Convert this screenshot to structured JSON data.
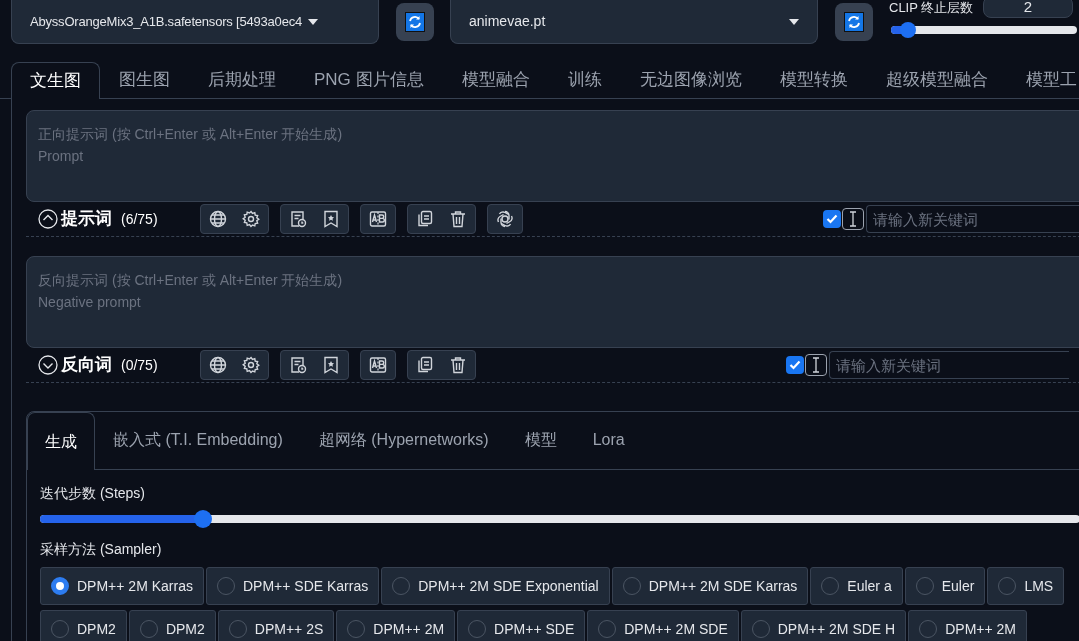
{
  "checkpoint": {
    "value": "AbyssOrangeMix3_A1B.safetensors [5493a0ec4"
  },
  "vae": {
    "value": "animevae.pt"
  },
  "clip_skip": {
    "label": "CLIP 终止层数",
    "value": "2",
    "level": 0.09
  },
  "tabs": [
    {
      "label": "文生图",
      "selected": true
    },
    {
      "label": "图生图",
      "selected": false
    },
    {
      "label": "后期处理",
      "selected": false
    },
    {
      "label": "PNG 图片信息",
      "selected": false
    },
    {
      "label": "模型融合",
      "selected": false
    },
    {
      "label": "训练",
      "selected": false
    },
    {
      "label": "无边图像浏览",
      "selected": false
    },
    {
      "label": "模型转换",
      "selected": false
    },
    {
      "label": "超级模型融合",
      "selected": false
    },
    {
      "label": "模型工",
      "selected": false
    }
  ],
  "prompts": [
    {
      "placeholder": "正向提示词 (按 Ctrl+Enter 或 Alt+Enter 开始生成)\nPrompt",
      "title": "提示词",
      "count": "(6/75)",
      "expanded": true,
      "tool_groups": [
        {
          "tools": [
            {
              "kind": "globe"
            },
            {
              "kind": "gear"
            }
          ]
        },
        {
          "tools": [
            {
              "kind": "history"
            },
            {
              "kind": "bookmark"
            }
          ]
        },
        {
          "tools": [
            {
              "kind": "ab"
            }
          ]
        },
        {
          "tools": [
            {
              "kind": "copy"
            },
            {
              "kind": "trash"
            }
          ]
        },
        {
          "tools": [
            {
              "kind": "ai"
            }
          ]
        }
      ],
      "keyword_toggle": {
        "checked": true
      },
      "keyword_field": {
        "placeholder": "请输入新关键词"
      }
    },
    {
      "placeholder": "反向提示词 (按 Ctrl+Enter 或 Alt+Enter 开始生成)\nNegative prompt",
      "title": "反向词",
      "count": "(0/75)",
      "expanded": false,
      "tool_groups": [
        {
          "tools": [
            {
              "kind": "globe"
            },
            {
              "kind": "gear"
            }
          ]
        },
        {
          "tools": [
            {
              "kind": "history"
            },
            {
              "kind": "bookmark"
            }
          ]
        },
        {
          "tools": [
            {
              "kind": "ab"
            }
          ]
        },
        {
          "tools": [
            {
              "kind": "copy"
            },
            {
              "kind": "trash"
            }
          ]
        }
      ],
      "keyword_toggle": {
        "checked": true
      },
      "keyword_field": {
        "placeholder": "请输入新关键词"
      }
    }
  ],
  "sub_tabs": [
    {
      "label": "生成",
      "selected": true
    },
    {
      "label": "嵌入式 (T.I. Embedding)",
      "selected": false
    },
    {
      "label": "超网络 (Hypernetworks)",
      "selected": false
    },
    {
      "label": "模型",
      "selected": false
    },
    {
      "label": "Lora",
      "selected": false
    }
  ],
  "steps": {
    "label": "迭代步数 (Steps)",
    "level": 0.157
  },
  "sampler": {
    "label": "采样方法 (Sampler)",
    "options": [
      {
        "label": "DPM++ 2M Karras",
        "selected": true
      },
      {
        "label": "DPM++ SDE Karras",
        "selected": false
      },
      {
        "label": "DPM++ 2M SDE Exponential",
        "selected": false
      },
      {
        "label": "DPM++ 2M SDE Karras",
        "selected": false
      },
      {
        "label": "Euler a",
        "selected": false
      },
      {
        "label": "Euler",
        "selected": false
      },
      {
        "label": "LMS",
        "selected": false
      },
      {
        "label": "DPM2",
        "selected": false
      },
      {
        "label": "DPM2",
        "selected": false
      },
      {
        "label": "DPM++ 2S",
        "selected": false
      },
      {
        "label": "DPM++ 2M",
        "selected": false
      },
      {
        "label": "DPM++ SDE",
        "selected": false
      },
      {
        "label": "DPM++ 2M SDE",
        "selected": false
      },
      {
        "label": "DPM++ 2M SDE H",
        "selected": false
      },
      {
        "label": "DPM++ 2M",
        "selected": false
      }
    ]
  }
}
